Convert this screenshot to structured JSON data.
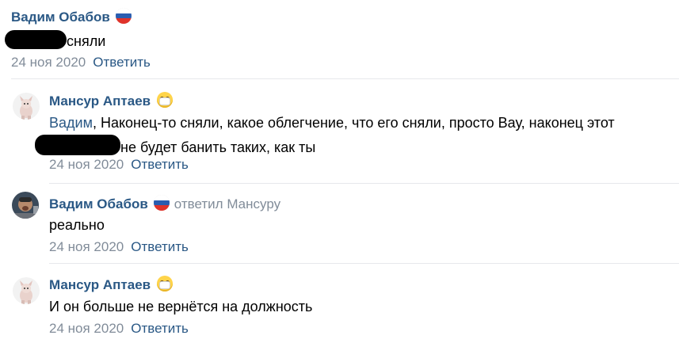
{
  "comments": [
    {
      "author": "Вадим Обабов",
      "text": "сняли",
      "date": "24 ноя 2020",
      "reply_label": "Ответить"
    },
    {
      "author": "Мансур Аптаев",
      "mention": "Вадим",
      "text_line1": ", Наконец-то сняли, какое облегчение, что его сняли, просто Вау, наконец этот",
      "text_line2": "не будет банить таких, как ты",
      "date": "24 ноя 2020",
      "reply_label": "Ответить"
    },
    {
      "author": "Вадим Обабов",
      "reply_to": "ответил Мансуру",
      "text": "реально",
      "date": "24 ноя 2020",
      "reply_label": "Ответить"
    },
    {
      "author": "Мансур Аптаев",
      "text": "И он больше не вернётся на должность",
      "date": "24 ноя 2020",
      "reply_label": "Ответить"
    }
  ],
  "icons": {
    "flag": "russia-flag-icon",
    "emoji": "face-with-medical-mask-icon"
  },
  "colors": {
    "link": "#2a5885",
    "meta": "#818c99",
    "separator": "#e7e8ec"
  }
}
